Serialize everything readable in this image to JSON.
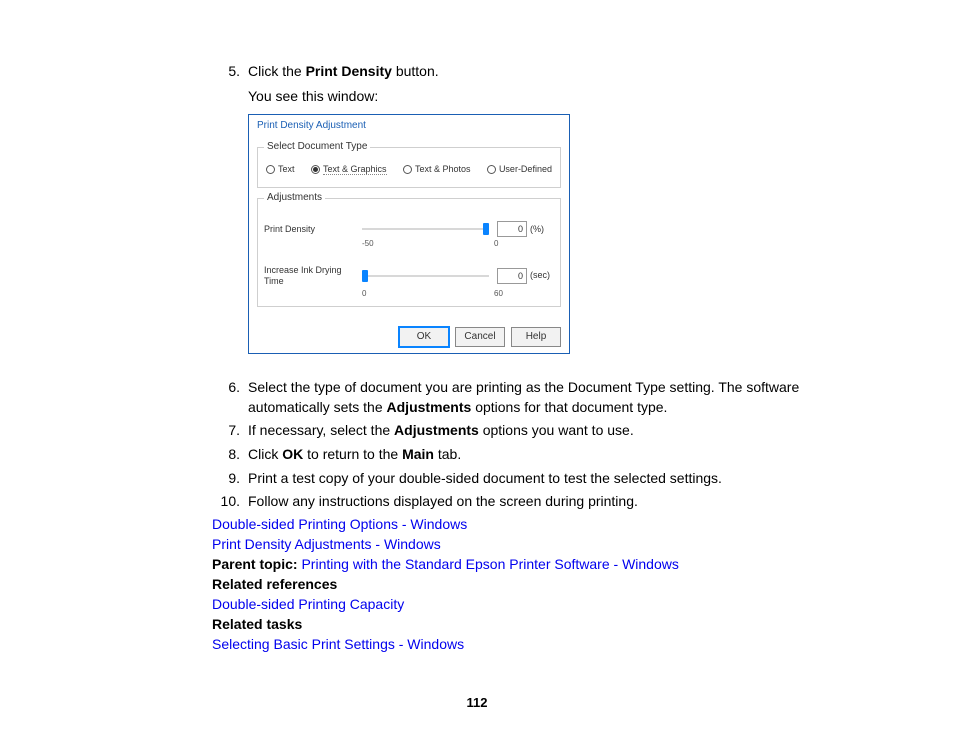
{
  "steps": {
    "s5": {
      "num": "5.",
      "text_pre": "Click the ",
      "text_bold": "Print Density",
      "text_post": " button."
    },
    "s5_sub": "You see this window:",
    "s6": {
      "num": "6.",
      "text_pre": "Select the type of document you are printing as the Document Type setting. The software automatically sets the ",
      "text_bold": "Adjustments",
      "text_post": " options for that document type."
    },
    "s7": {
      "num": "7.",
      "text_pre": "If necessary, select the ",
      "text_bold": "Adjustments",
      "text_post": " options you want to use."
    },
    "s8": {
      "num": "8.",
      "text_pre": "Click ",
      "text_bold1": "OK",
      "text_mid": " to return to the ",
      "text_bold2": "Main",
      "text_post": " tab."
    },
    "s9": {
      "num": "9.",
      "text": "Print a test copy of your double-sided document to test the selected settings."
    },
    "s10": {
      "num": "10.",
      "text": "Follow any instructions displayed on the screen during printing."
    }
  },
  "links": {
    "l1": "Double-sided Printing Options - Windows",
    "l2": "Print Density Adjustments - Windows",
    "parent_label": "Parent topic: ",
    "parent_link": "Printing with the Standard Epson Printer Software - Windows",
    "related_ref": "Related references",
    "ref_link": "Double-sided Printing Capacity",
    "related_tasks": "Related tasks",
    "task_link": "Selecting Basic Print Settings - Windows"
  },
  "dialog": {
    "title": "Print Density Adjustment",
    "group1": "Select Document Type",
    "radios": {
      "r1": "Text",
      "r2": "Text & Graphics",
      "r3": "Text & Photos",
      "r4": "User-Defined"
    },
    "group2": "Adjustments",
    "adj1": {
      "label": "Print Density",
      "value": "0",
      "unit": "(%)",
      "scale_left": "-50",
      "scale_right": "0"
    },
    "adj2": {
      "label": "Increase Ink Drying Time",
      "value": "0",
      "unit": "(sec)",
      "scale_left": "0",
      "scale_right": "60"
    },
    "buttons": {
      "ok": "OK",
      "cancel": "Cancel",
      "help": "Help"
    }
  },
  "page_number": "112"
}
